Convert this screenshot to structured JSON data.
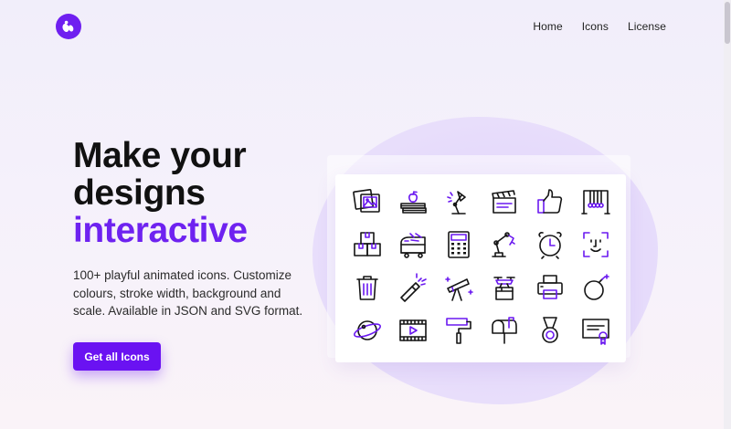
{
  "brand": {
    "logo_icon": "paw-logo-icon",
    "accent_color": "#6e22f0"
  },
  "nav": {
    "items": [
      {
        "label": "Home"
      },
      {
        "label": "Icons"
      },
      {
        "label": "License"
      }
    ]
  },
  "hero": {
    "title_line1": "Make your",
    "title_line2": "designs",
    "title_accent": "interactive",
    "description": "100+ playful animated icons. Customize colours, stroke width, background and scale. Available in JSON and SVG format.",
    "cta_label": "Get all Icons"
  },
  "icon_grid": {
    "icons": [
      "photo-gallery-icon",
      "books-apple-icon",
      "desk-lamp-icon",
      "clapperboard-icon",
      "thumbs-up-icon",
      "newtons-cradle-icon",
      "boxes-icon",
      "tram-icon",
      "calculator-icon",
      "robotic-arm-icon",
      "alarm-clock-icon",
      "face-id-icon",
      "trash-bin-icon",
      "flashlight-icon",
      "telescope-icon",
      "drone-delivery-icon",
      "printer-icon",
      "bomb-icon",
      "planet-icon",
      "video-player-icon",
      "paint-roller-icon",
      "mailbox-icon",
      "medal-icon",
      "certificate-icon"
    ]
  }
}
